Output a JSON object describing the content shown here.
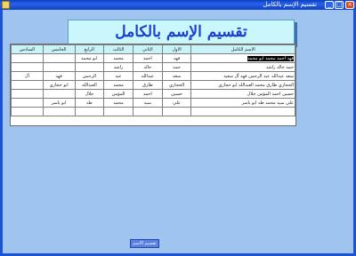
{
  "window": {
    "title": "تقسيم الإسم بالكامل",
    "minimize_glyph": "_",
    "maximize_glyph": "□",
    "close_glyph": "×",
    "icon": "app-icon"
  },
  "heading": "تقسيم الإسم بالكامل",
  "table": {
    "columns": [
      "الاسم الكامل",
      "الاول",
      "الثاني",
      "الثالث",
      "الرابع",
      "الخامس",
      "السادس"
    ],
    "rows": [
      [
        "فهد احمد محمد ابو محمد",
        "فهد",
        "احمد",
        "محمد",
        "ابو محمد",
        "",
        ""
      ],
      [
        "حمد خالد راشد",
        "حمد",
        "خالد",
        "راشد",
        "",
        "",
        ""
      ],
      [
        "سعد عبدالله عبد الرحمن فهد آل سعيد",
        "سعد",
        "عبدالله",
        "عبد",
        "الرحمن",
        "فهد",
        "آل"
      ],
      [
        "الحجازي طارق محمد العبدالله ابو حجازي",
        "الحجازي",
        "طارق",
        "محمد",
        "العبدالله",
        "ابو حجازي",
        ""
      ],
      [
        "حسين احمد المؤمن جلال",
        "حسين",
        "احمد",
        "المؤمن",
        "جلال",
        "",
        ""
      ],
      [
        "علي سيد محمد طه ابو ياسر",
        "علي",
        "سيد",
        "محمد",
        "طه",
        "ابو ياسر",
        ""
      ]
    ]
  },
  "divide_button": "تقسيم الاسم"
}
